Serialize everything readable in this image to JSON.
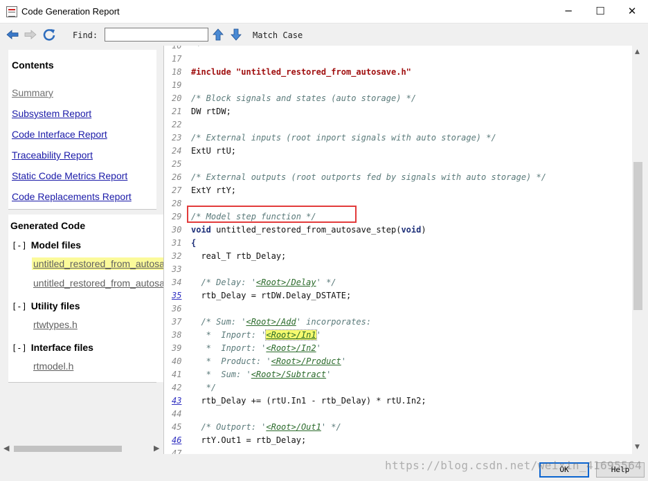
{
  "window": {
    "title": "Code Generation Report",
    "minimize": "─",
    "maximize": "☐",
    "close": "✕"
  },
  "toolbar": {
    "back_icon": "back-arrow-icon",
    "forward_icon": "forward-arrow-icon",
    "refresh_icon": "refresh-icon",
    "find_label": "Find:",
    "find_value": "",
    "up_icon": "find-previous-arrow-icon",
    "down_icon": "find-next-arrow-icon",
    "match_case": "Match Case"
  },
  "contents": {
    "heading": "Contents",
    "links": [
      {
        "label": "Summary",
        "visited": true
      },
      {
        "label": "Subsystem Report"
      },
      {
        "label": "Code Interface Report"
      },
      {
        "label": "Traceability Report"
      },
      {
        "label": "Static Code Metrics Report"
      },
      {
        "label": "Code Replacements Report"
      }
    ]
  },
  "generated_code": {
    "heading": "Generated Code",
    "toggle": "[-]",
    "groups": [
      {
        "label": "Model files",
        "files": [
          "untitled_restored_from_autosave.c",
          "untitled_restored_from_autosave.h"
        ]
      },
      {
        "label": "Utility files",
        "files": [
          "rtwtypes.h"
        ]
      },
      {
        "label": "Interface files",
        "files": [
          "rtmodel.h"
        ]
      }
    ]
  },
  "code": {
    "lines": [
      {
        "n": "16",
        "parts": [
          {
            "t": " *",
            "c": "cm"
          }
        ]
      },
      {
        "n": "17",
        "parts": []
      },
      {
        "n": "18",
        "parts": [
          {
            "t": "#include ",
            "c": "pp"
          },
          {
            "t": "\"untitled_restored_from_autosave.h\"",
            "c": "str"
          }
        ]
      },
      {
        "n": "19",
        "parts": []
      },
      {
        "n": "20",
        "parts": [
          {
            "t": "/* Block signals and states (auto storage) */",
            "c": "cm"
          }
        ]
      },
      {
        "n": "21",
        "parts": [
          {
            "t": "DW rtDW;"
          }
        ]
      },
      {
        "n": "22",
        "parts": []
      },
      {
        "n": "23",
        "parts": [
          {
            "t": "/* External inputs (root inport signals with auto storage) */",
            "c": "cm"
          }
        ]
      },
      {
        "n": "24",
        "parts": [
          {
            "t": "ExtU rtU;"
          }
        ]
      },
      {
        "n": "25",
        "parts": []
      },
      {
        "n": "26",
        "parts": [
          {
            "t": "/* External outputs (root outports fed by signals with auto storage) */",
            "c": "cm"
          }
        ]
      },
      {
        "n": "27",
        "parts": [
          {
            "t": "ExtY rtY;"
          }
        ]
      },
      {
        "n": "28",
        "parts": []
      },
      {
        "n": "29",
        "parts": [
          {
            "t": "/* Model step function */",
            "c": "cm"
          }
        ]
      },
      {
        "n": "30",
        "parts": [
          {
            "t": "void",
            "c": "kw"
          },
          {
            "t": " untitled_restored_from_autosave_step("
          },
          {
            "t": "void",
            "c": "kw"
          },
          {
            "t": ")"
          }
        ]
      },
      {
        "n": "31",
        "parts": [
          {
            "t": "{",
            "c": "kw"
          }
        ]
      },
      {
        "n": "32",
        "parts": [
          {
            "t": "  real_T rtb_Delay;"
          }
        ]
      },
      {
        "n": "33",
        "parts": []
      },
      {
        "n": "34",
        "parts": [
          {
            "t": "  /* Delay: '",
            "c": "cm"
          },
          {
            "t": "<Root>/Delay",
            "c": "cref"
          },
          {
            "t": "' */",
            "c": "cm"
          }
        ]
      },
      {
        "n": "35",
        "link": true,
        "parts": [
          {
            "t": "  rtb_Delay = rtDW.Delay_DSTATE;"
          }
        ]
      },
      {
        "n": "36",
        "parts": []
      },
      {
        "n": "37",
        "parts": [
          {
            "t": "  /* Sum: '",
            "c": "cm"
          },
          {
            "t": "<Root>/Add",
            "c": "cref"
          },
          {
            "t": "' incorporates:",
            "c": "cm"
          }
        ]
      },
      {
        "n": "38",
        "parts": [
          {
            "t": "   *  Inport: '",
            "c": "cm"
          },
          {
            "t": "<Root>/In1",
            "c": "cref hl"
          },
          {
            "t": "'",
            "c": "cm"
          }
        ]
      },
      {
        "n": "39",
        "parts": [
          {
            "t": "   *  Inport: '",
            "c": "cm"
          },
          {
            "t": "<Root>/In2",
            "c": "cref"
          },
          {
            "t": "'",
            "c": "cm"
          }
        ]
      },
      {
        "n": "40",
        "parts": [
          {
            "t": "   *  Product: '",
            "c": "cm"
          },
          {
            "t": "<Root>/Product",
            "c": "cref"
          },
          {
            "t": "'",
            "c": "cm"
          }
        ]
      },
      {
        "n": "41",
        "parts": [
          {
            "t": "   *  Sum: '",
            "c": "cm"
          },
          {
            "t": "<Root>/Subtract",
            "c": "cref"
          },
          {
            "t": "'",
            "c": "cm"
          }
        ]
      },
      {
        "n": "42",
        "parts": [
          {
            "t": "   */",
            "c": "cm"
          }
        ]
      },
      {
        "n": "43",
        "link": true,
        "parts": [
          {
            "t": "  rtb_Delay += (rtU.In1 - rtb_Delay) * rtU.In2;"
          }
        ]
      },
      {
        "n": "44",
        "parts": []
      },
      {
        "n": "45",
        "parts": [
          {
            "t": "  /* Outport: '",
            "c": "cm"
          },
          {
            "t": "<Root>/Out1",
            "c": "cref"
          },
          {
            "t": "' */",
            "c": "cm"
          }
        ]
      },
      {
        "n": "46",
        "link": true,
        "parts": [
          {
            "t": "  rtY.Out1 = rtb_Delay;"
          }
        ]
      },
      {
        "n": "47",
        "parts": []
      }
    ]
  },
  "buttons": {
    "ok": "OK",
    "help": "Help"
  },
  "watermark": "https://blog.csdn.net/weixin_41695564",
  "colors": {
    "link": "#1a1aa8",
    "selection_highlight": "#fbfa9a",
    "annotation_box": "#e23a3a"
  }
}
